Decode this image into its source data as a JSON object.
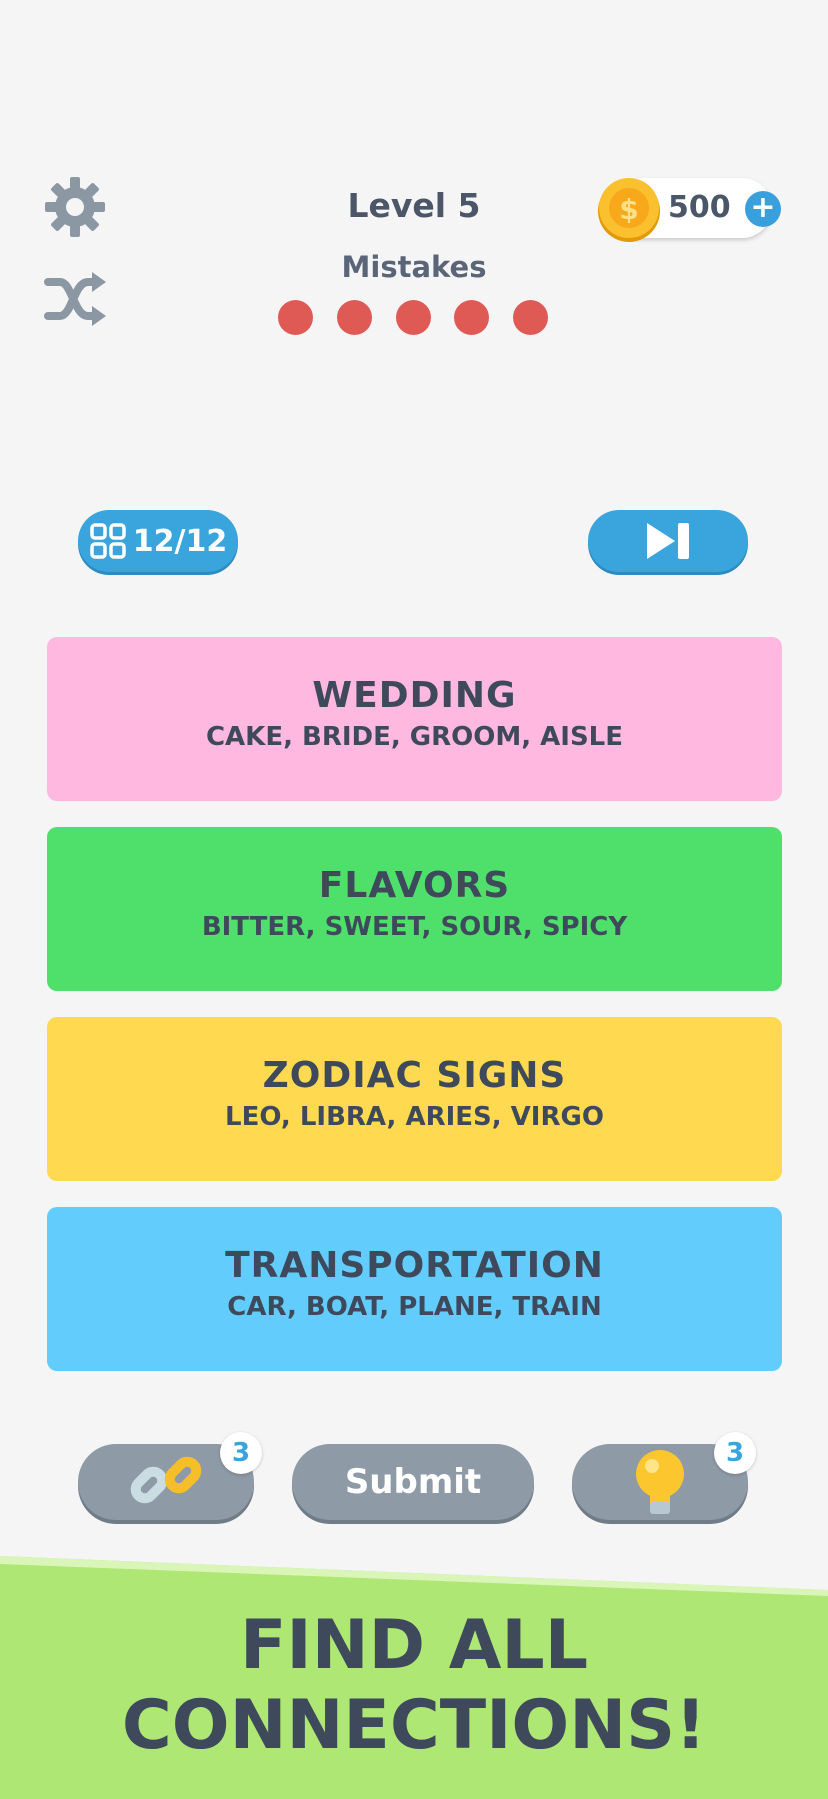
{
  "header": {
    "level": "Level 5",
    "mistakes_label": "Mistakes",
    "mistakes_remaining": 5,
    "coins": "500"
  },
  "progress": {
    "text": "12/12"
  },
  "categories": [
    {
      "title": "WEDDING",
      "words": "CAKE, BRIDE, GROOM, AISLE",
      "color": "#ffb8e0"
    },
    {
      "title": "FLAVORS",
      "words": "BITTER, SWEET, SOUR, SPICY",
      "color": "#4fe06c"
    },
    {
      "title": "ZODIAC SIGNS",
      "words": "LEO, LIBRA, ARIES, VIRGO",
      "color": "#ffd94f"
    },
    {
      "title": "TRANSPORTATION",
      "words": "CAR, BOAT, PLANE, TRAIN",
      "color": "#62cdfd"
    }
  ],
  "actions": {
    "link_count": "3",
    "submit_label": "Submit",
    "hint_count": "3"
  },
  "banner": {
    "line1": "FIND ALL",
    "line2": "CONNECTIONS!"
  },
  "icons": [
    "gear-icon",
    "shuffle-icon",
    "coin-icon",
    "plus-icon",
    "grid-icon",
    "skip-icon",
    "link-icon",
    "lightbulb-icon"
  ]
}
